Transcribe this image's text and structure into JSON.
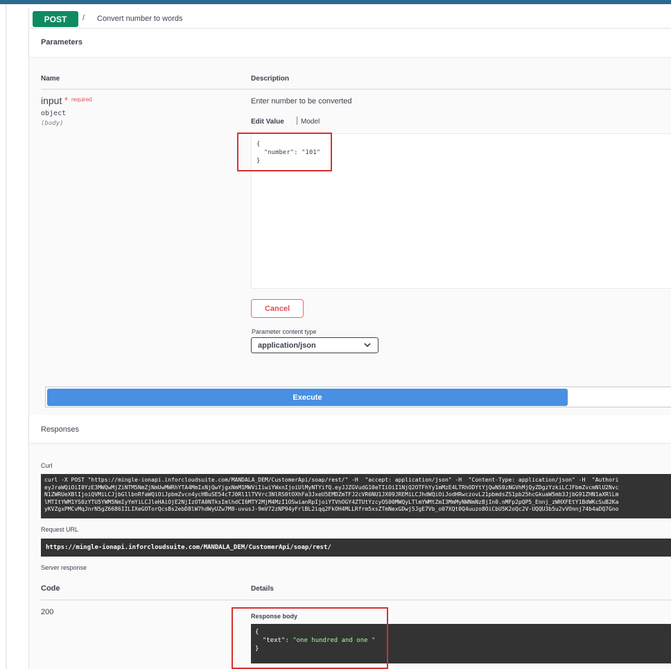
{
  "operation": {
    "method": "POST",
    "separator": "/",
    "description": "Convert number to words"
  },
  "parameters": {
    "title": "Parameters",
    "col_name": "Name",
    "col_description": "Description",
    "param": {
      "name": "input",
      "required_mark": "*",
      "required_label": "required",
      "type": "object",
      "location": "(body)",
      "description": "Enter number to be converted",
      "tab_edit": "Edit Value",
      "tab_model": "Model",
      "value_lines": [
        "{",
        "  \"number\": \"101\"",
        "}"
      ]
    },
    "cancel_label": "Cancel",
    "content_type_label": "Parameter content type",
    "content_type_value": "application/json"
  },
  "execute_label": "Execute",
  "responses": {
    "title": "Responses",
    "curl_label": "Curl",
    "curl_lines": [
      "curl -X POST \"https://mingle-ionapi.inforcloudsuite.com/MANDALA_DEM/CustomerApi/soap/rest/\" -H  \"accept: application/json\" -H  \"Content-Type: application/json\" -H  \"Authori",
      "eyJraWQiOiI0YzE3MWQwMjZiNTM5NmZjNmUwMWRhYTA4MmIxNjQwYjgxNmM1MWViIiwiYWxnIjoiUlMyNTYifQ.eyJJZGVudG10eTIiOiI1NjQ2OTFhYy1mMzE4LTRhODYtYjQwNS0zNGVhMjQyZDgzYzkiLCJFbmZvcmNlU2Nvc",
      "N1ZWRUeXBlIjoiQVMiLCJjbGllbnRfaWQiOiJpbmZvcn4ycHBuSE54cTJ0Rl1lTVVrc3NlRS0tOXhFa3JxeU5EMDZmTFJ2cVR6NU1JX09JREMiLCJhdWQiOiJodHRwczovL21pbmdsZS1pb25hcGkuaW5mb3JjbG91ZHN1aXRlLm",
      "lMTItYWM1YS0zYTU5YWM5NmIyYmYiLCJleHAiOjE2NjIzOTA0NTksImlhdCI6MTY2MjM4MzI1OSwianRpIjoiYTVhOGY4ZTUtYzcyOS00MWQyLTlmYWMtZmI3MmMyNWNmNzBjIn0.nMFp2pQP5_Ennj_zWHXFEtY1BdWKcSuB2Ka",
      "yKVZgxPMCvMqJnrN5gZ6686IILIXeGOTorQcsBs2ebD8lW7hdWyUZw7M8-uvusJ-9mV72zNP94yFrlBL2iqq2FkOH4MLLRfrm5xsZTmNexGDwj5JgE7Vb_o07XQt0Q4uuzo8OiCbU5K2oQc2V-UQQU3b5u2vVOnnj74b4aDQ7Gno"
    ],
    "request_url_label": "Request URL",
    "request_url": "https://mingle-ionapi.inforcloudsuite.com/MANDALA_DEM/CustomerApi/soap/rest/",
    "server_response_label": "Server response",
    "col_code": "Code",
    "col_details": "Details",
    "code": "200",
    "response_body_label": "Response body",
    "body_open": "{",
    "body_key": "  \"text\": ",
    "body_value": "\"one hundred and one \"",
    "body_close": "}"
  },
  "colors": {
    "post_method": "#0f8a63",
    "execute": "#4990e2",
    "cancel": "#e04f4f",
    "highlight": "#d62f2f"
  }
}
